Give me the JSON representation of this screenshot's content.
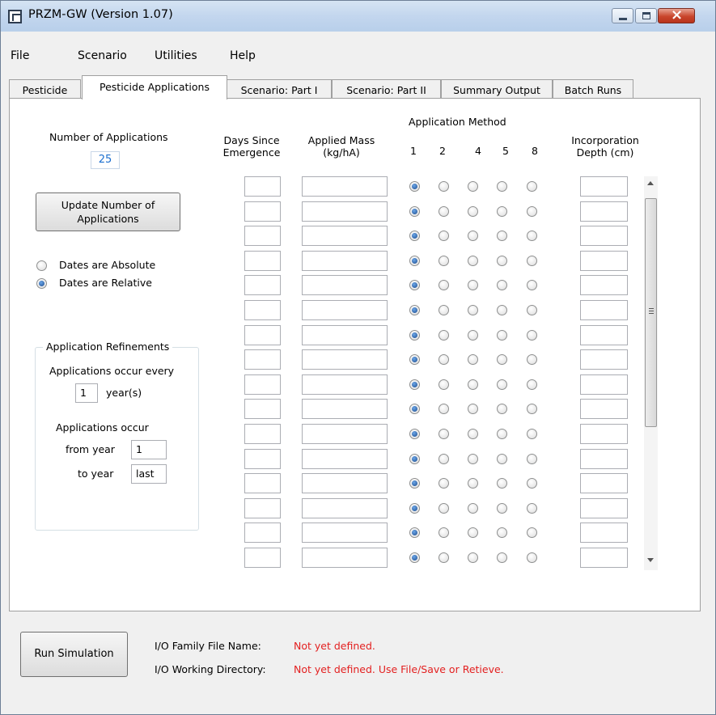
{
  "window": {
    "title": "PRZM-GW (Version 1.07)"
  },
  "menu": [
    "File",
    "Scenario",
    "Utilities",
    "Help"
  ],
  "tabs": [
    "Pesticide",
    "Pesticide Applications",
    "Scenario:  Part I",
    "Scenario: Part II",
    "Summary Output",
    "Batch Runs"
  ],
  "left": {
    "num_apps_label": "Number of Applications",
    "num_apps_value": "25",
    "update_button": [
      "Update Number of",
      "Applications"
    ],
    "dates_absolute": "Dates are Absolute",
    "dates_relative": "Dates are Relative",
    "dates_mode": "relative"
  },
  "refinements": {
    "title": "Application Refinements",
    "every_label": "Applications occur every",
    "every_value": "1",
    "every_unit": "year(s)",
    "occur_label": "Applications occur",
    "from_label": "from year",
    "from_value": "1",
    "to_label": "to year",
    "to_value": "last"
  },
  "grid": {
    "days_header": [
      "Days Since",
      "Emergence"
    ],
    "mass_header": [
      "Applied  Mass",
      "(kg/hA)"
    ],
    "method_header": "Application  Method",
    "methods": [
      "1",
      "2",
      "4",
      "5",
      "8"
    ],
    "depth_header": [
      "Incorporation",
      "Depth (cm)"
    ],
    "visible_rows": 16,
    "selected_method": "1"
  },
  "footer": {
    "run_button": "Run Simulation",
    "family_label": "I/O Family File Name:",
    "family_value": "Not yet defined.",
    "dir_label": "I/O Working Directory:",
    "dir_value": "Not yet defined. Use File/Save or Retieve."
  },
  "colors": {
    "error_text": "#e31f1f",
    "value_blue": "#1a6ecf"
  }
}
